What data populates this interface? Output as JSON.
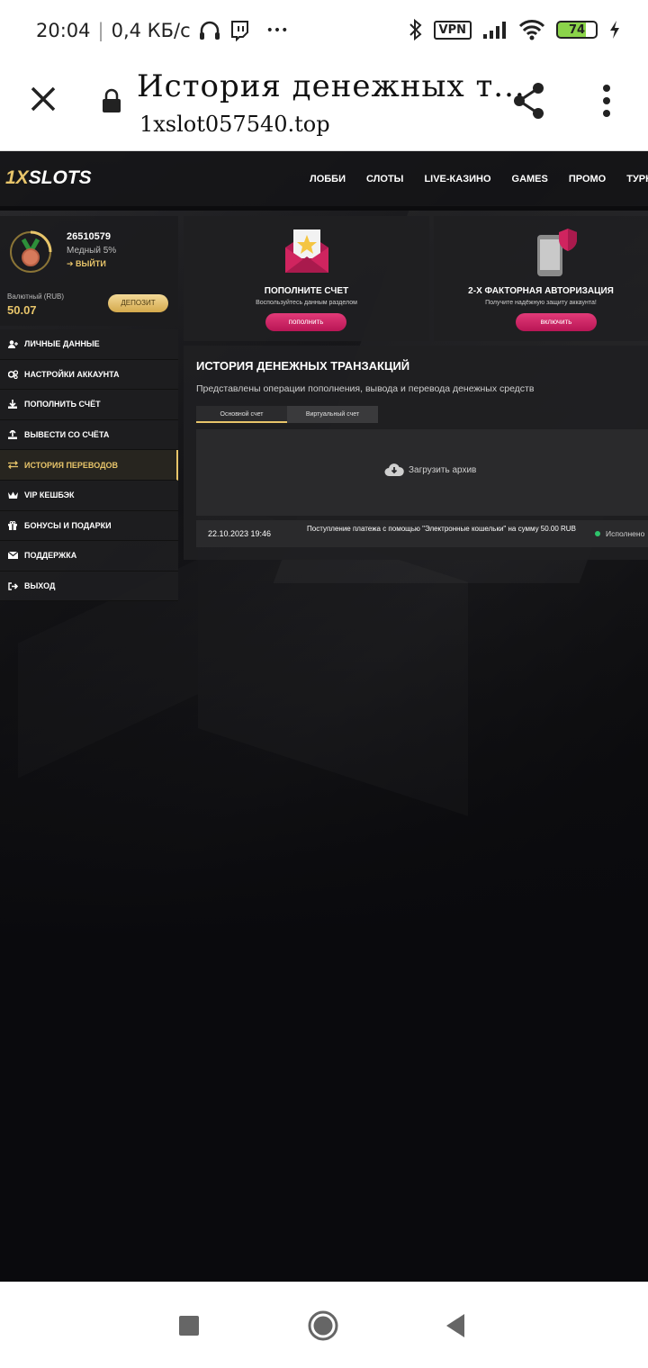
{
  "status_bar": {
    "time": "20:04",
    "separator": "|",
    "speed": "0,4 КБ/с",
    "vpn": "VPN",
    "battery": "74",
    "dots": "•••"
  },
  "browser": {
    "title": "История денежных т...",
    "url": "1xslot057540.top"
  },
  "site": {
    "logo_prefix": "1X",
    "logo_rest": "SLOTS",
    "nav": [
      "ЛОББИ",
      "СЛОТЫ",
      "LIVE-КАЗИНО",
      "GAMES",
      "ПРОМО",
      "ТУРНИРЫ"
    ],
    "profile": {
      "user_id": "26510579",
      "level": "Медный 5%",
      "logout": "ВЫЙТИ",
      "balance_label": "Валютный (RUB)",
      "balance": "50.07",
      "deposit_button": "ДЕПОЗИТ"
    },
    "menu": [
      {
        "label": "ЛИЧНЫЕ ДАННЫЕ",
        "icon": "user-plus-icon"
      },
      {
        "label": "НАСТРОЙКИ АККАУНТА",
        "icon": "gears-icon"
      },
      {
        "label": "ПОПОЛНИТЬ СЧЁТ",
        "icon": "download-icon"
      },
      {
        "label": "ВЫВЕСТИ СО СЧЁТА",
        "icon": "upload-icon"
      },
      {
        "label": "ИСТОРИЯ ПЕРЕВОДОВ",
        "icon": "transfer-arrows-icon",
        "active": true
      },
      {
        "label": "VIP КЕШБЭК",
        "icon": "crown-icon"
      },
      {
        "label": "БОНУСЫ И ПОДАРКИ",
        "icon": "gift-icon"
      },
      {
        "label": "ПОДДЕРЖКА",
        "icon": "envelope-icon"
      },
      {
        "label": "ВЫХОД",
        "icon": "sign-out-icon"
      }
    ],
    "promo_cards": [
      {
        "title": "ПОПОЛНИТЕ СЧЕТ",
        "subtitle": "Воспользуйтесь данным разделом",
        "button": "пополнить",
        "icon": "envelope-star-icon"
      },
      {
        "title": "2-Х ФАКТОРНАЯ АВТОРИЗАЦИЯ",
        "subtitle": "Получите надёжную защиту аккаунта!",
        "button": "включить",
        "icon": "phone-shield-icon"
      }
    ],
    "history": {
      "title": "ИСТОРИЯ ДЕНЕЖНЫХ ТРАНЗАКЦИЙ",
      "description": "Представлены операции пополнения, вывода и перевода денежных средств",
      "tabs": [
        "Основной счет",
        "Виртуальный счет"
      ],
      "active_tab": 0,
      "archive_label": "Загрузить архив",
      "transactions": [
        {
          "date": "22.10.2023 19:46",
          "description": "Поступление платежа с помощью \"Электронные кошельки\" на сумму 50.00 RUB",
          "status": "Исполнено"
        }
      ]
    }
  },
  "colors": {
    "accent_gold": "#e8c56a",
    "accent_pink": "#d0245f",
    "status_green": "#2ec46b"
  }
}
